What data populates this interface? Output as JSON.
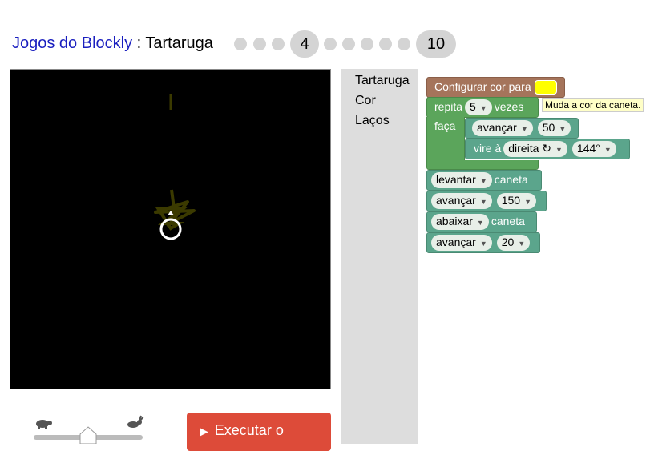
{
  "header": {
    "app_link": "Jogos do Blockly",
    "separator": " : ",
    "page_title": "Tartaruga",
    "levels": {
      "current": "4",
      "last": "10"
    }
  },
  "toolbox": {
    "items": [
      "Tartaruga",
      "Cor",
      "Laços"
    ]
  },
  "blocks": {
    "set_color_label": "Configurar cor para",
    "set_color_value": "#ffff00",
    "repeat_label": "repita",
    "repeat_count": "5",
    "repeat_suffix": "vezes",
    "do_label": "faça",
    "forward1_dropdown": "avançar",
    "forward1_value": "50",
    "turn_label": "vire à",
    "turn_dropdown": "direita ↻",
    "turn_value": "144°",
    "penup_dropdown": "levantar",
    "penup_suffix": "caneta",
    "forward2_dropdown": "avançar",
    "forward2_value": "150",
    "pendown_dropdown": "abaixar",
    "pendown_suffix": "caneta",
    "forward3_dropdown": "avançar",
    "forward3_value": "20"
  },
  "tooltip": "Muda a cor da caneta.",
  "controls": {
    "run_label": "Executar o"
  },
  "colors": {
    "accent": "#dd4b39",
    "link": "#1a1fbf",
    "pen": "#3b3a00"
  },
  "icons": [
    "turtle-icon",
    "rabbit-icon",
    "play-icon",
    "dropdown-caret-icon"
  ]
}
